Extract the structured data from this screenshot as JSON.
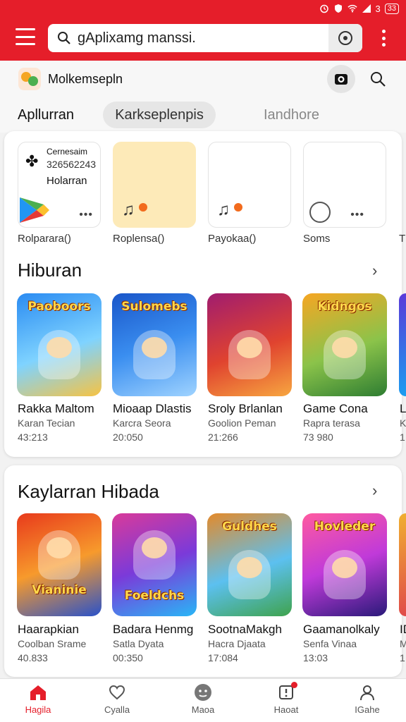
{
  "status_bar": {
    "battery": "3",
    "battery_box": "33"
  },
  "search": {
    "query": "gAplixamg manssi."
  },
  "app": {
    "name": "Molkemsepln"
  },
  "tabs": [
    {
      "label": "Apllurran"
    },
    {
      "label": "Karkseplenpis"
    },
    {
      "label": "Iandhore"
    }
  ],
  "quick": {
    "card1": {
      "title": "Cernesaim",
      "number": "326562243",
      "subtitle": "Holarran"
    },
    "labels": [
      "Rolparara()",
      "Roplensa()",
      "Payokaa()",
      "Soms",
      "T"
    ]
  },
  "sections": [
    {
      "title": "Hiburan",
      "items": [
        {
          "art": "Paoboors",
          "name": "Rakka Maltom",
          "sub": "Karan Tecian",
          "value": "43:213"
        },
        {
          "art": "Sulomebs",
          "name": "Mioaap Dlastis",
          "sub": "Karcra Seora",
          "value": "20:050"
        },
        {
          "art": "",
          "name": "Sroly Brlanlan",
          "sub": "Goolion Peman",
          "value": "21:266"
        },
        {
          "art": "Kidngos",
          "name": "Game Cona",
          "sub": "Rapra terasa",
          "value": "73 980"
        },
        {
          "art": "",
          "name": "L",
          "sub": "K",
          "value": "1"
        }
      ]
    },
    {
      "title": "Kaylarran Hibada",
      "items": [
        {
          "art": "Vianinie",
          "name": "Haarapkian",
          "sub": "Coolban Srame",
          "value": "40.833"
        },
        {
          "art": "Foeldchs",
          "name": "Badara Henmg",
          "sub": "Satla Dyata",
          "value": "00:350"
        },
        {
          "art": "Guldhes",
          "name": "SootnaMakgh",
          "sub": "Hacra Djaata",
          "value": "17:084"
        },
        {
          "art": "Hovleder",
          "name": "Gaamanolkaly",
          "sub": "Senfa Vinaa",
          "value": "13:03"
        },
        {
          "art": "",
          "name": "ID",
          "sub": "M",
          "value": "1"
        }
      ]
    }
  ],
  "bottom_nav": [
    {
      "label": "Hagila",
      "icon": "home-icon"
    },
    {
      "label": "Cyalla",
      "icon": "heart-icon"
    },
    {
      "label": "Maoa",
      "icon": "face-icon"
    },
    {
      "label": "Haoat",
      "icon": "notification-icon"
    },
    {
      "label": "IGahe",
      "icon": "profile-icon"
    }
  ],
  "colors": {
    "brand": "#e51e2a",
    "active_nav": "#e51e2a"
  }
}
